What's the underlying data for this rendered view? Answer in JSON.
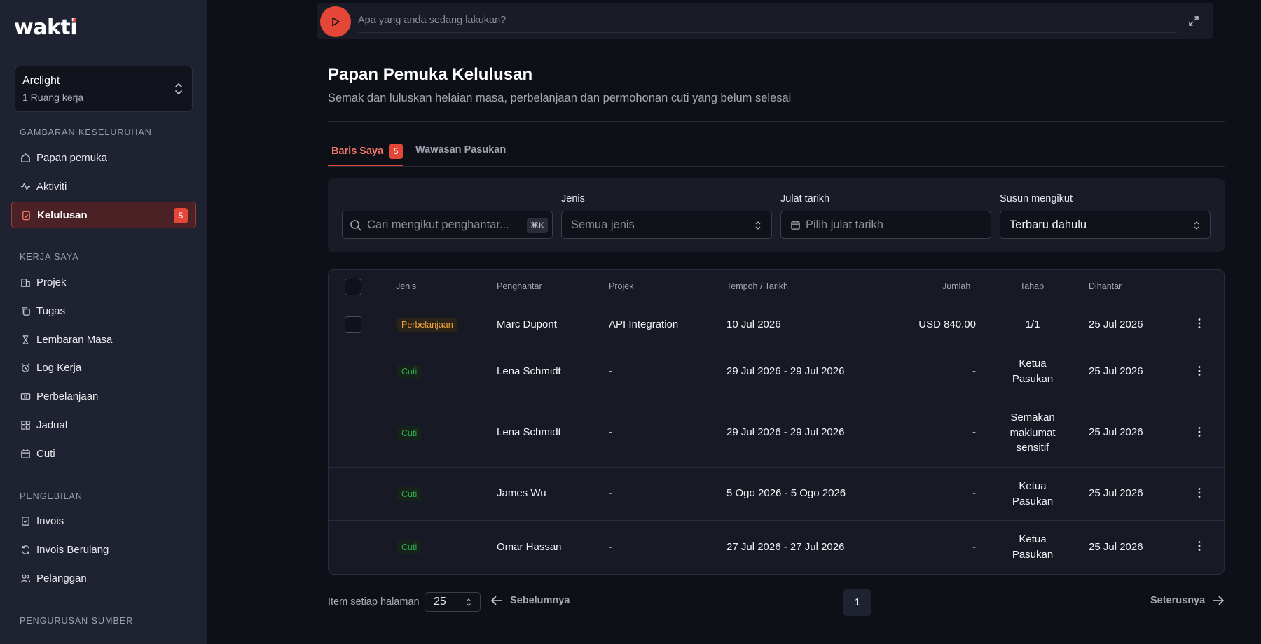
{
  "app": {
    "logo": "wakti"
  },
  "workspace": {
    "name": "Arclight",
    "sub": "1 Ruang kerja"
  },
  "sidebar": {
    "sections": [
      {
        "label": "GAMBARAN KESELURUHAN",
        "items": [
          {
            "label": "Papan pemuka",
            "icon": "home-icon"
          },
          {
            "label": "Aktiviti",
            "icon": "activity-icon"
          },
          {
            "label": "Kelulusan",
            "icon": "clipboard-check-icon",
            "active": true,
            "count": "5"
          }
        ]
      },
      {
        "label": "KERJA SAYA",
        "items": [
          {
            "label": "Projek",
            "icon": "building-icon"
          },
          {
            "label": "Tugas",
            "icon": "copy-icon"
          },
          {
            "label": "Lembaran Masa",
            "icon": "hourglass-icon"
          },
          {
            "label": "Log Kerja",
            "icon": "alarm-clock-icon"
          },
          {
            "label": "Perbelanjaan",
            "icon": "banknote-icon"
          },
          {
            "label": "Jadual",
            "icon": "grid-icon"
          },
          {
            "label": "Cuti",
            "icon": "calendar-icon"
          }
        ]
      },
      {
        "label": "PENGEBILAN",
        "items": [
          {
            "label": "Invois",
            "icon": "invoice-icon"
          },
          {
            "label": "Invois Berulang",
            "icon": "refresh-icon"
          },
          {
            "label": "Pelanggan",
            "icon": "users-icon"
          }
        ]
      },
      {
        "label": "PENGURUSAN SUMBER",
        "items": []
      }
    ]
  },
  "timer": {
    "placeholder": "Apa yang anda sedang lakukan?"
  },
  "header": {
    "title": "Papan Pemuka Kelulusan",
    "subtitle": "Semak dan luluskan helaian masa, perbelanjaan dan permohonan cuti yang belum selesai"
  },
  "tabs": {
    "mine": "Baris Saya",
    "mine_count": "5",
    "team": "Wawasan Pasukan"
  },
  "filters": {
    "search_placeholder": "Cari mengikut penghantar...",
    "search_kbd": "⌘K",
    "type_label": "Jenis",
    "type_value": "Semua jenis",
    "date_label": "Julat tarikh",
    "date_value": "Pilih julat tarikh",
    "sort_label": "Susun mengikut",
    "sort_value": "Terbaru dahulu"
  },
  "table": {
    "headers": [
      "Jenis",
      "Penghantar",
      "Projek",
      "Tempoh / Tarikh",
      "Jumlah",
      "Tahap",
      "Dihantar"
    ],
    "rows": [
      {
        "type": "Perbelanjaan",
        "kind": "expense",
        "submitter": "Marc Dupont",
        "project": "API Integration",
        "period": "10 Jul 2026",
        "amount": "USD 840.00",
        "stage": [
          "1/1"
        ],
        "submitted": "25 Jul 2026",
        "checkbox": true
      },
      {
        "type": "Cuti",
        "kind": "leave",
        "submitter": "Lena Schmidt",
        "project": "-",
        "period": "29 Jul 2026 - 29 Jul 2026",
        "amount": "-",
        "stage": [
          "Ketua",
          "Pasukan"
        ],
        "submitted": "25 Jul 2026"
      },
      {
        "type": "Cuti",
        "kind": "leave",
        "submitter": "Lena Schmidt",
        "project": "-",
        "period": "29 Jul 2026 - 29 Jul 2026",
        "amount": "-",
        "stage": [
          "Semakan",
          "maklumat",
          "sensitif"
        ],
        "submitted": "25 Jul 2026"
      },
      {
        "type": "Cuti",
        "kind": "leave",
        "submitter": "James Wu",
        "project": "-",
        "period": "5 Ogo 2026 - 5 Ogo 2026",
        "amount": "-",
        "stage": [
          "Ketua",
          "Pasukan"
        ],
        "submitted": "25 Jul 2026"
      },
      {
        "type": "Cuti",
        "kind": "leave",
        "submitter": "Omar Hassan",
        "project": "-",
        "period": "27 Jul 2026 - 27 Jul 2026",
        "amount": "-",
        "stage": [
          "Ketua",
          "Pasukan"
        ],
        "submitted": "25 Jul 2026"
      }
    ]
  },
  "pagination": {
    "per_page_label": "Item setiap halaman",
    "per_page_value": "25",
    "prev": "Sebelumnya",
    "current": "1",
    "next": "Seterusnya"
  },
  "colors": {
    "accent": "#e44638",
    "expense": "#f0a23c",
    "leave": "#2ea84a",
    "bg": "#0e1017",
    "sidebar": "#1f2230"
  }
}
